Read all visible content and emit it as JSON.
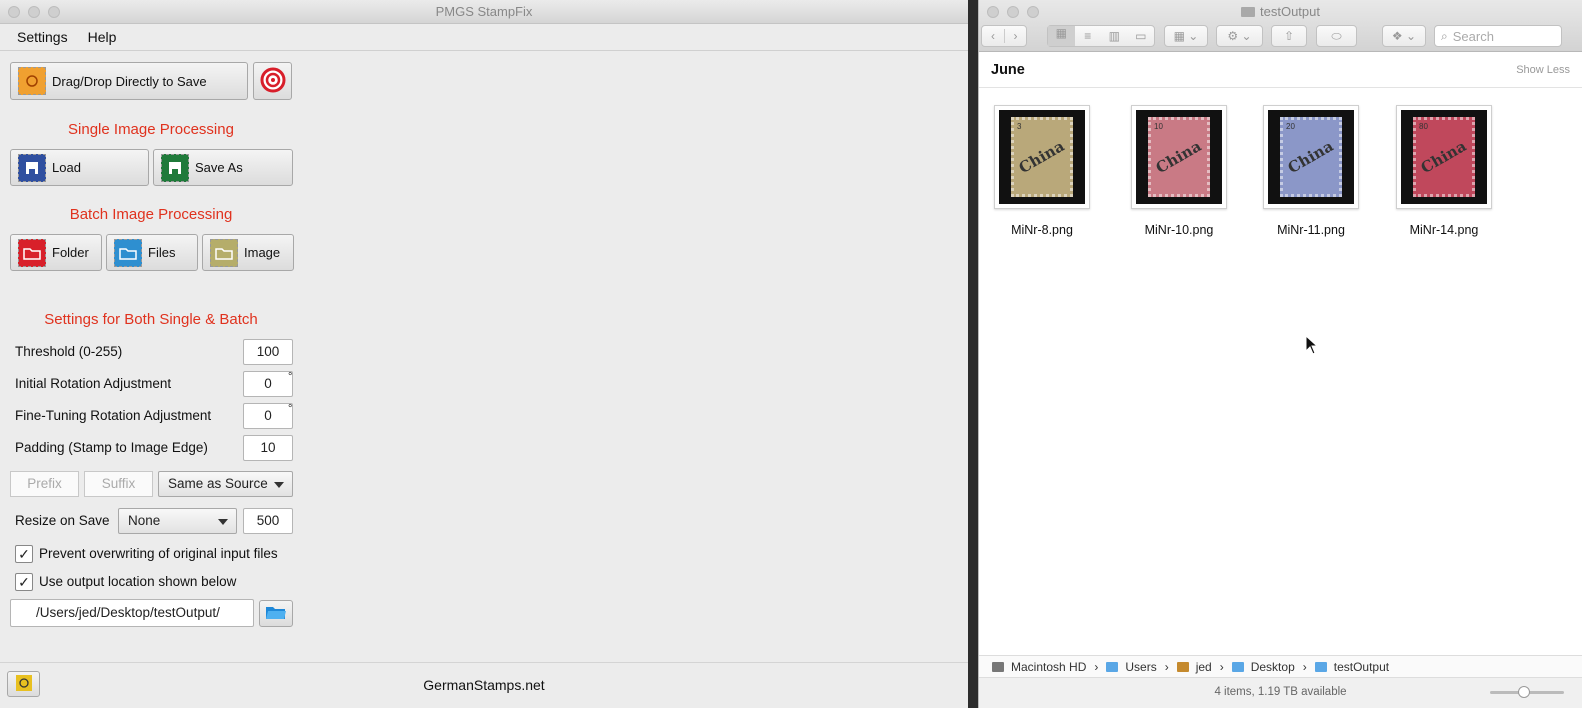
{
  "app": {
    "title": "PMGS StampFix",
    "menu": [
      "Settings",
      "Help"
    ],
    "dragdrop_label": "Drag/Drop Directly to Save",
    "single_heading": "Single Image Processing",
    "load_label": "Load",
    "saveas_label": "Save As",
    "batch_heading": "Batch Image Processing",
    "folder_label": "Folder",
    "files_label": "Files",
    "image_label": "Image",
    "settings_heading": "Settings for Both Single & Batch",
    "threshold_label": "Threshold (0-255)",
    "threshold_value": "100",
    "rotation_label": "Initial Rotation Adjustment",
    "rotation_value": "0",
    "finetune_label": "Fine-Tuning Rotation Adjustment",
    "finetune_value": "0",
    "degree_symbol": "°",
    "padding_label": "Padding (Stamp to Image Edge)",
    "padding_value": "10",
    "prefix_placeholder": "Prefix",
    "suffix_placeholder": "Suffix",
    "naming_option": "Same as Source",
    "resize_label": "Resize on Save",
    "resize_option": "None",
    "resize_value": "500",
    "prevent_overwrite_label": "Prevent overwriting of original input files",
    "prevent_overwrite_checked": true,
    "use_output_label": "Use output location shown below",
    "use_output_checked": true,
    "check_glyph": "✓",
    "output_path": "/Users/jed/Desktop/testOutput/",
    "footer_text": "GermanStamps.net",
    "heading_color": "#e0321e"
  },
  "finder": {
    "title": "testOutput",
    "search_placeholder": "Search",
    "section_title": "June",
    "show_less": "Show Less",
    "files": [
      {
        "name": "MiNr-8.png",
        "value": "3",
        "color": "#b9a87a"
      },
      {
        "name": "MiNr-10.png",
        "value": "10",
        "color": "#c97a85"
      },
      {
        "name": "MiNr-11.png",
        "value": "20",
        "color": "#8b97c8"
      },
      {
        "name": "MiNr-14.png",
        "value": "80",
        "color": "#c0485c"
      }
    ],
    "overprint": "China",
    "path": [
      "Macintosh HD",
      "Users",
      "jed",
      "Desktop",
      "testOutput"
    ],
    "path_sep": "›",
    "status": "4 items, 1.19 TB available"
  }
}
